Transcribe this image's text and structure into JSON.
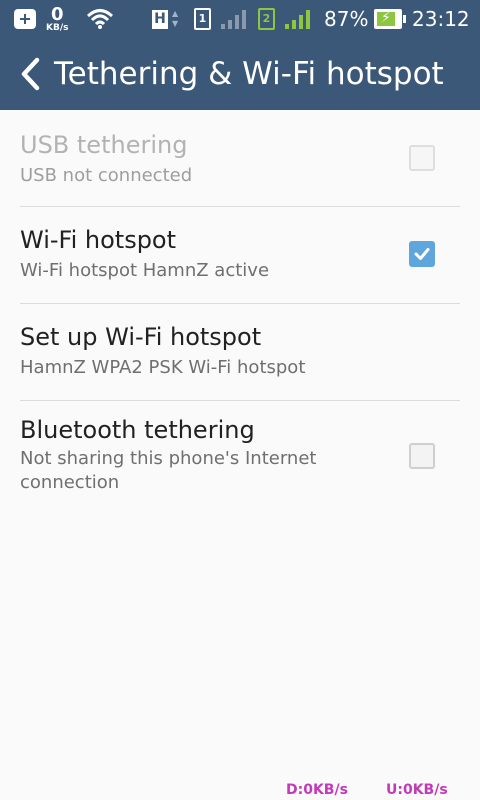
{
  "status_bar": {
    "net_speed_value": "0",
    "net_speed_unit": "KB/s",
    "sim1_label": "1",
    "sim2_label": "2",
    "network_type": "H",
    "battery_percent": "87%",
    "time": "23:12",
    "accent_color": "#8dc63f",
    "background_color": "#3b5878"
  },
  "header": {
    "title": "Tethering & Wi-Fi hotspot",
    "background_color": "#3b5878"
  },
  "settings": [
    {
      "title": "USB tethering",
      "summary": "USB not connected",
      "checkbox": true,
      "checked": false,
      "enabled": false
    },
    {
      "title": "Wi-Fi hotspot",
      "summary": "Wi-Fi hotspot HamnZ active",
      "checkbox": true,
      "checked": true,
      "enabled": true
    },
    {
      "title": "Set up Wi-Fi hotspot",
      "summary": "HamnZ WPA2 PSK Wi-Fi hotspot",
      "checkbox": false,
      "enabled": true
    },
    {
      "title": "Bluetooth tethering",
      "summary": "Not sharing this phone's Internet connection",
      "checkbox": true,
      "checked": false,
      "enabled": true
    }
  ],
  "footer": {
    "download_speed": "D:0KB/s",
    "upload_speed": "U:0KB/s",
    "color": "#c23ab8"
  },
  "checkbox_color": "#5fa6dc"
}
